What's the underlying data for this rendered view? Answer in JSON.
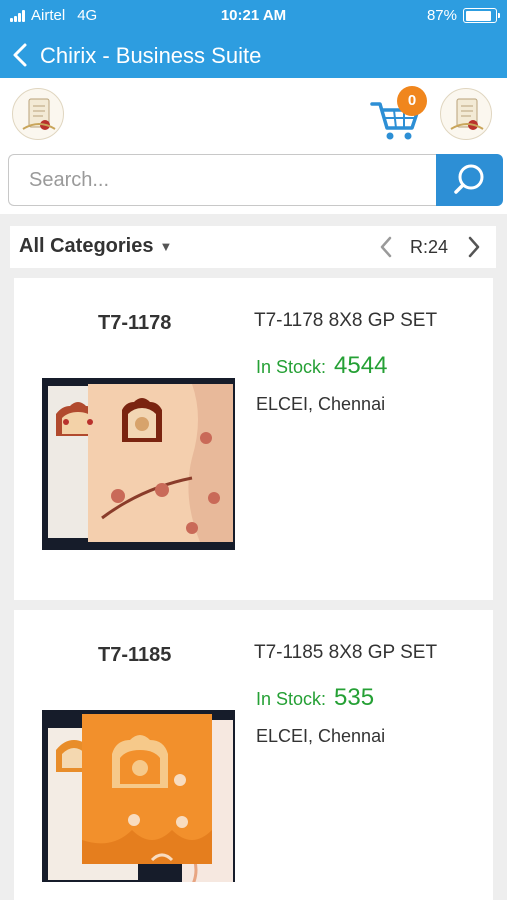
{
  "status_bar": {
    "carrier": "Airtel",
    "network": "4G",
    "time": "10:21 AM",
    "battery": "87%",
    "battery_level": 0.87
  },
  "nav": {
    "title": "Chirix - Business Suite",
    "back_icon": "chevron-left-icon"
  },
  "header": {
    "cart_count": "0",
    "cart_icon": "shopping-cart-icon"
  },
  "search": {
    "placeholder": "Search...",
    "value": "",
    "icon": "search-icon"
  },
  "filter": {
    "category": "All Categories",
    "range": "R:24"
  },
  "products": [
    {
      "code": "T7-1178",
      "name": "T7-1178 8X8 GP SET",
      "stock_label": "In Stock:",
      "stock_qty": "4544",
      "location": "ELCEI, Chennai"
    },
    {
      "code": "T7-1185",
      "name": "T7-1185 8X8 GP SET",
      "stock_label": "In Stock:",
      "stock_qty": "535",
      "location": "ELCEI, Chennai"
    }
  ],
  "colors": {
    "accent": "#2d9de0",
    "badge": "#f0861d",
    "stock": "#25a035"
  }
}
